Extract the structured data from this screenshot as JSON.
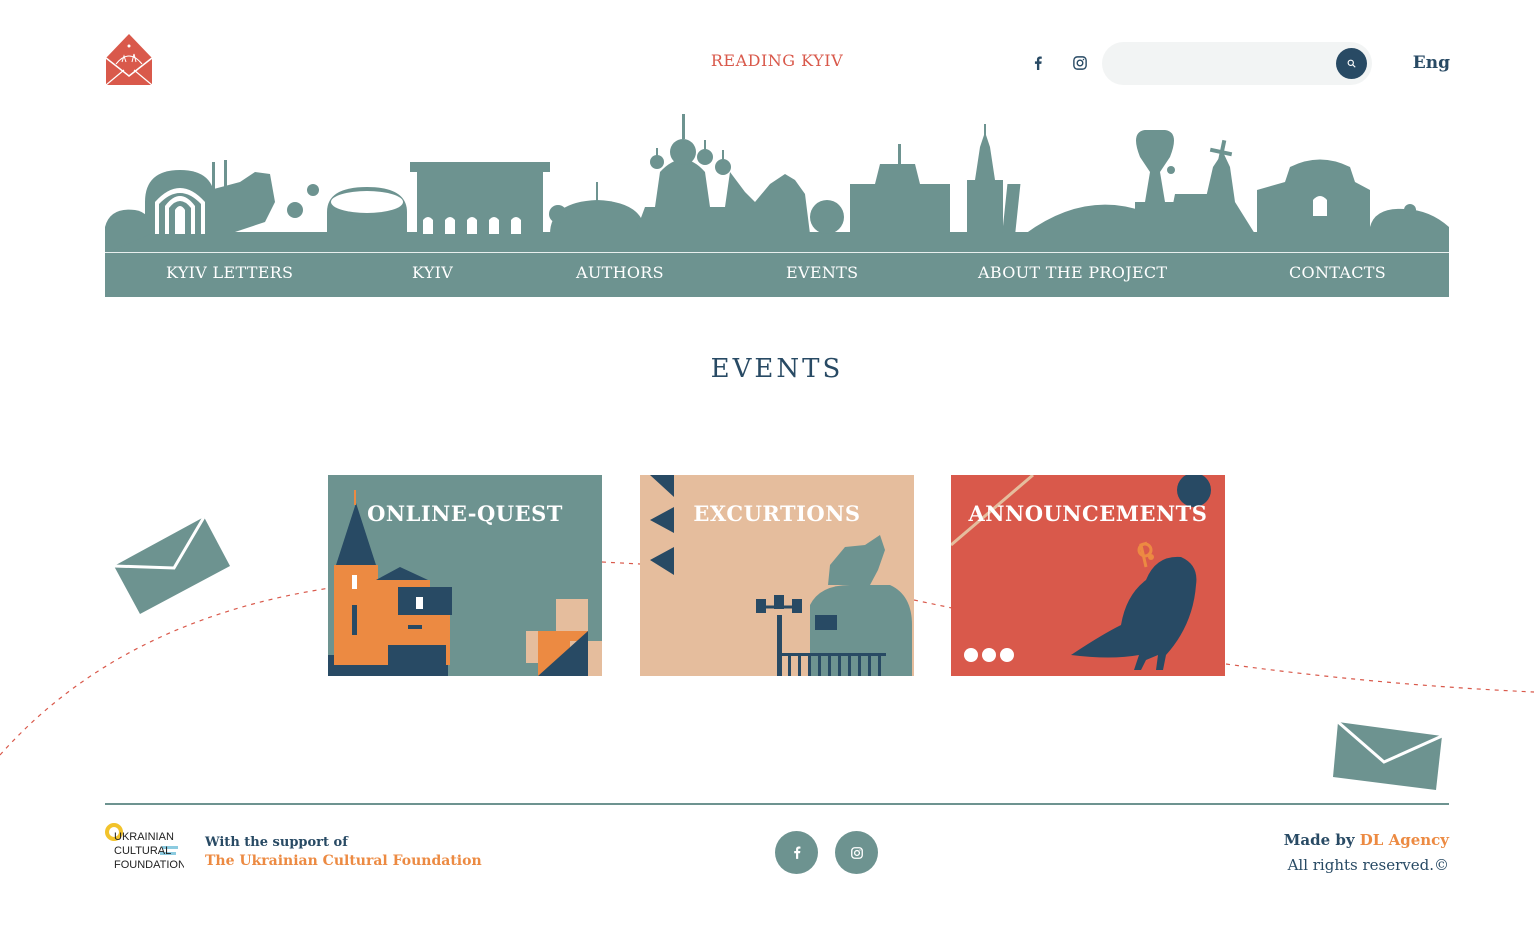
{
  "header": {
    "site_title": "READING KYIV",
    "language": "Eng",
    "search": {
      "value": "",
      "placeholder": ""
    },
    "icons": [
      "logo-envelope-icon",
      "facebook-icon",
      "instagram-icon",
      "search-icon"
    ]
  },
  "nav": {
    "items": [
      {
        "label": "KYIV LETTERS"
      },
      {
        "label": "KYIV"
      },
      {
        "label": "AUTHORS"
      },
      {
        "label": "EVENTS"
      },
      {
        "label": "ABOUT THE PROJECT"
      },
      {
        "label": "CONTACTS"
      }
    ]
  },
  "main": {
    "title": "EVENTS",
    "cards": [
      {
        "title": "ONLINE-QUEST"
      },
      {
        "title": "EXCURTIONS"
      },
      {
        "title": "ANNOUNCEMENTS"
      }
    ]
  },
  "footer": {
    "support_label": "With the support of",
    "support_org": "The Ukrainian Cultural Foundation",
    "ucf_logo_lines": [
      "UKRAINIAN",
      "CULTURAL",
      "FOUNDATION"
    ],
    "made_by_label": "Made by",
    "made_by_agency": "DL Agency",
    "rights": "All rights reserved.©"
  },
  "colors": {
    "teal": "#6d9390",
    "navy": "#284a64",
    "red": "#d9594b",
    "orange": "#ec8a42",
    "peach": "#e5bd9d"
  }
}
